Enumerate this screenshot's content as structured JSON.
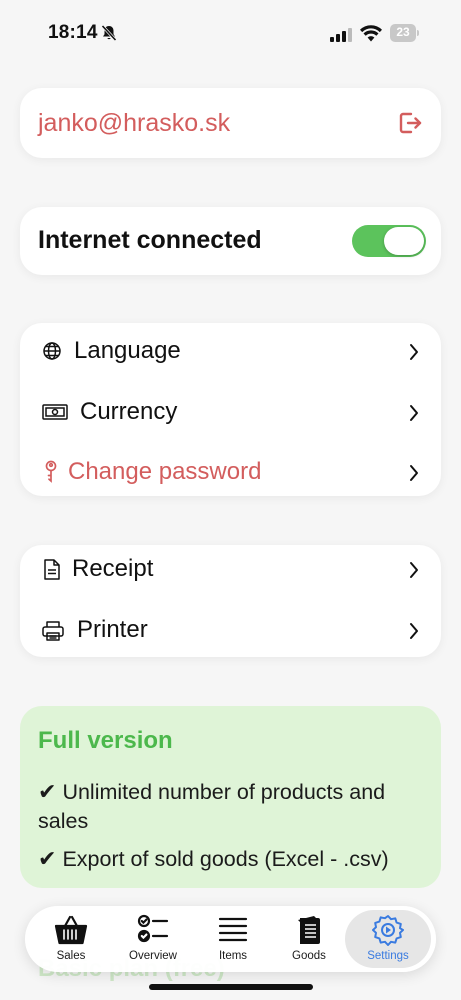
{
  "status_bar": {
    "time": "18:14",
    "battery": "23"
  },
  "account": {
    "email": "janko@hrasko.sk"
  },
  "internet": {
    "label": "Internet connected",
    "enabled": true
  },
  "menu_group_1": [
    {
      "label": "Language",
      "icon": "globe-icon"
    },
    {
      "label": "Currency",
      "icon": "banknote-icon"
    },
    {
      "label": "Change password",
      "icon": "key-icon"
    }
  ],
  "menu_group_2": [
    {
      "label": "Receipt",
      "icon": "document-icon"
    },
    {
      "label": "Printer",
      "icon": "printer-icon"
    }
  ],
  "full_version": {
    "title": "Full version",
    "features": [
      {
        "check": "✔",
        "text": "Unlimited number of products and sales"
      },
      {
        "check": "✔",
        "text": "Export of sold goods (Excel - .csv)"
      }
    ]
  },
  "next_card_peek": "Basic plan (free)",
  "tabs": [
    {
      "label": "Sales",
      "icon": "basket-icon"
    },
    {
      "label": "Overview",
      "icon": "checklist-icon"
    },
    {
      "label": "Items",
      "icon": "list-icon"
    },
    {
      "label": "Goods",
      "icon": "notebook-icon"
    },
    {
      "label": "Settings",
      "icon": "gear-icon",
      "active": true
    }
  ],
  "colors": {
    "accent_red": "#d35d5d",
    "accent_green": "#4cb84c",
    "toggle_green": "#5cc35c",
    "active_tab_blue": "#3a7be0",
    "full_card_bg": "#dff4d7"
  }
}
